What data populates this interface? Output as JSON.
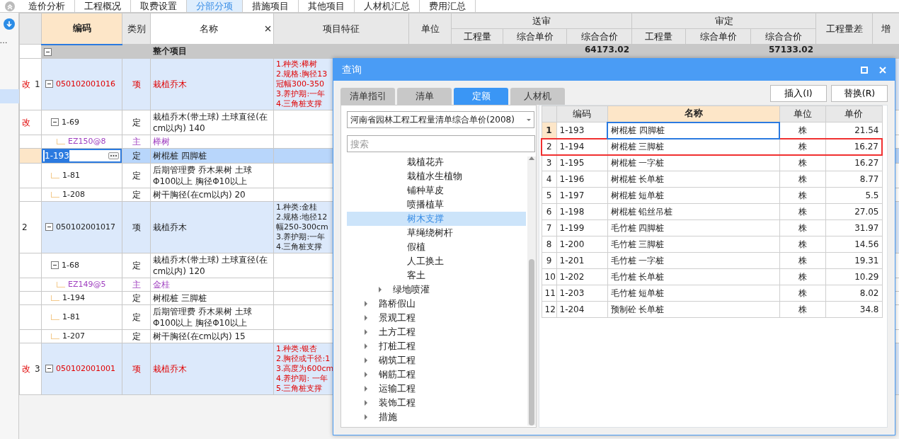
{
  "top_tabs": [
    {
      "label": "造价分析",
      "selected": false
    },
    {
      "label": "工程概况",
      "selected": false
    },
    {
      "label": "取费设置",
      "selected": false
    },
    {
      "label": "分部分项",
      "selected": true
    },
    {
      "label": "措施项目",
      "selected": false
    },
    {
      "label": "其他项目",
      "selected": false
    },
    {
      "label": "人材机汇总",
      "selected": false
    },
    {
      "label": "费用汇总",
      "selected": false
    }
  ],
  "sidebar": {
    "items": [
      {
        "label": "…",
        "selected": false
      },
      {
        "selected": true
      }
    ]
  },
  "grid": {
    "columns": [
      {
        "label": "编码",
        "selected": true
      },
      {
        "label": "类别",
        "selected": false
      },
      {
        "label": "名称",
        "selected": false,
        "closable": true
      },
      {
        "label": "项目特征",
        "selected": false
      },
      {
        "label": "单位",
        "selected": false
      },
      {
        "group": "送审",
        "children": [
          "工程量",
          "综合单价",
          "综合合价"
        ]
      },
      {
        "group": "审定",
        "children": [
          "工程量",
          "综合单价",
          "综合合价"
        ]
      },
      {
        "label": "工程量差",
        "selected": false
      },
      {
        "label": "增",
        "selected": false
      }
    ],
    "total": {
      "name": "整个项目",
      "submitted_total": "64173.02",
      "approved_total": "57133.02",
      "expanded": true,
      "children": [
        {
          "flag": "改",
          "number": "1",
          "code": "050102001016",
          "type": "项",
          "name": "栽植乔木",
          "kind": "item",
          "modified": true,
          "expanded": true,
          "selected": false,
          "features": [
            "1.种类:榉树",
            "2.规格:胸径13",
            "冠幅300-350",
            "3.养护期:一年",
            "4.三角桩支撑"
          ],
          "children": [
            {
              "flag": "改",
              "code": "1-69",
              "type": "定",
              "name": "栽植乔木(带土球) 土球直径(在cm以内) 140",
              "kind": "quota",
              "expanded": true,
              "selected": false,
              "children": [
                {
                  "code": "EZ150@8",
                  "type": "主",
                  "name": "榉树",
                  "kind": "material",
                  "selected": false
                }
              ]
            },
            {
              "code": "1-193",
              "type": "定",
              "name": "树棍桩  四脚桩",
              "kind": "quota",
              "selected": true
            },
            {
              "code": "1-81",
              "type": "定",
              "name": "后期管理费 乔木果树 土球 Φ100以上 胸径Φ10以上",
              "kind": "quota",
              "selected": false
            },
            {
              "code": "1-208",
              "type": "定",
              "name": "树干胸径(在cm以内) 20",
              "kind": "quota",
              "selected": false
            }
          ]
        },
        {
          "number": "2",
          "code": "050102001017",
          "type": "项",
          "name": "栽植乔木",
          "kind": "item",
          "modified": false,
          "expanded": true,
          "selected": false,
          "features": [
            "1.种类:金桂",
            "2.规格:地径12",
            "幅250-300cm",
            "3.养护期:一年",
            "4.三角桩支撑"
          ],
          "children": [
            {
              "code": "1-68",
              "type": "定",
              "name": "栽植乔木(带土球) 土球直径(在cm以内) 120",
              "kind": "quota",
              "expanded": true,
              "selected": false,
              "children": [
                {
                  "code": "EZ149@5",
                  "type": "主",
                  "name": "金桂",
                  "kind": "material",
                  "selected": false
                }
              ]
            },
            {
              "code": "1-194",
              "type": "定",
              "name": "树棍桩  三脚桩",
              "kind": "quota",
              "selected": false
            },
            {
              "code": "1-81",
              "type": "定",
              "name": "后期管理费 乔木果树 土球 Φ100以上 胸径Φ10以上",
              "kind": "quota",
              "selected": false
            },
            {
              "code": "1-207",
              "type": "定",
              "name": "树干胸径(在cm以内) 15",
              "kind": "quota",
              "selected": false
            }
          ]
        },
        {
          "flag": "改",
          "number": "3",
          "code": "050102001001",
          "type": "项",
          "name": "栽植乔木",
          "kind": "item",
          "modified": true,
          "expanded": true,
          "selected": false,
          "features": [
            "1.种类:银杏",
            "2.胸径或干径:1",
            "3.高度为600cm",
            "4.养护期: 一年",
            "5.三角桩支撑"
          ]
        }
      ]
    }
  },
  "dialog": {
    "title": "查询",
    "tabs": [
      {
        "label": "清单指引",
        "selected": false
      },
      {
        "label": "清单",
        "selected": false
      },
      {
        "label": "定额",
        "selected": true
      },
      {
        "label": "人材机",
        "selected": false
      }
    ],
    "buttons": [
      "插入(I)",
      "替换(R)"
    ],
    "library": "河南省园林工程工程量清单综合单价(2008)",
    "search": {
      "placeholder": "搜索"
    },
    "tree": [
      {
        "children": [
          {
            "children": [
              {
                "label": "栽植花卉",
                "selected": false
              },
              {
                "label": "栽植水生植物",
                "selected": false
              },
              {
                "label": "铺种草皮",
                "selected": false
              },
              {
                "label": "喷播植草",
                "selected": false
              },
              {
                "label": "树木支撑",
                "selected": true
              },
              {
                "label": "草绳绕树杆",
                "selected": false
              },
              {
                "label": "假植",
                "selected": false
              },
              {
                "label": "人工换土",
                "selected": false
              },
              {
                "label": "客土",
                "selected": false
              }
            ]
          },
          {
            "label": "绿地喷灌",
            "expanded": false,
            "selected": false
          }
        ]
      },
      {
        "label": "路桥假山",
        "expanded": false,
        "selected": false
      },
      {
        "label": "景观工程",
        "expanded": false,
        "selected": false
      },
      {
        "label": "土方工程",
        "expanded": false,
        "selected": false
      },
      {
        "label": "打桩工程",
        "expanded": false,
        "selected": false
      },
      {
        "label": "砌筑工程",
        "expanded": false,
        "selected": false
      },
      {
        "label": "钢筋工程",
        "expanded": false,
        "selected": false
      },
      {
        "label": "运输工程",
        "expanded": false,
        "selected": false
      },
      {
        "label": "装饰工程",
        "expanded": false,
        "selected": false
      },
      {
        "label": "措施",
        "expanded": false,
        "selected": false
      }
    ],
    "table": {
      "columns": [
        "编码",
        "名称",
        "单位",
        "单价"
      ],
      "rows": [
        {
          "number": "1",
          "code": "1-193",
          "name": "树棍桩  四脚桩",
          "unit": "株",
          "price": "21.54",
          "selected": true,
          "highlighted": false
        },
        {
          "number": "2",
          "code": "1-194",
          "name": "树棍桩  三脚桩",
          "unit": "株",
          "price": "16.27",
          "selected": false,
          "highlighted": true
        },
        {
          "number": "3",
          "code": "1-195",
          "name": "树棍桩  一字桩",
          "unit": "株",
          "price": "16.27",
          "selected": false,
          "highlighted": false
        },
        {
          "number": "4",
          "code": "1-196",
          "name": "树棍桩  长单桩",
          "unit": "株",
          "price": "8.77",
          "selected": false,
          "highlighted": false
        },
        {
          "number": "5",
          "code": "1-197",
          "name": "树棍桩  短单桩",
          "unit": "株",
          "price": "5.5",
          "selected": false,
          "highlighted": false
        },
        {
          "number": "6",
          "code": "1-198",
          "name": "树棍桩  铅丝吊桩",
          "unit": "株",
          "price": "27.05",
          "selected": false,
          "highlighted": false
        },
        {
          "number": "7",
          "code": "1-199",
          "name": "毛竹桩  四脚桩",
          "unit": "株",
          "price": "31.97",
          "selected": false,
          "highlighted": false
        },
        {
          "number": "8",
          "code": "1-200",
          "name": "毛竹桩  三脚桩",
          "unit": "株",
          "price": "14.56",
          "selected": false,
          "highlighted": false
        },
        {
          "number": "9",
          "code": "1-201",
          "name": "毛竹桩  一字桩",
          "unit": "株",
          "price": "19.31",
          "selected": false,
          "highlighted": false
        },
        {
          "number": "10",
          "code": "1-202",
          "name": "毛竹桩  长单桩",
          "unit": "株",
          "price": "10.29",
          "selected": false,
          "highlighted": false
        },
        {
          "number": "11",
          "code": "1-203",
          "name": "毛竹桩  短单桩",
          "unit": "株",
          "price": "8.02",
          "selected": false,
          "highlighted": false
        },
        {
          "number": "12",
          "code": "1-204",
          "name": "预制砼  长单桩",
          "unit": "株",
          "price": "34.8",
          "selected": false,
          "highlighted": false
        }
      ]
    }
  }
}
